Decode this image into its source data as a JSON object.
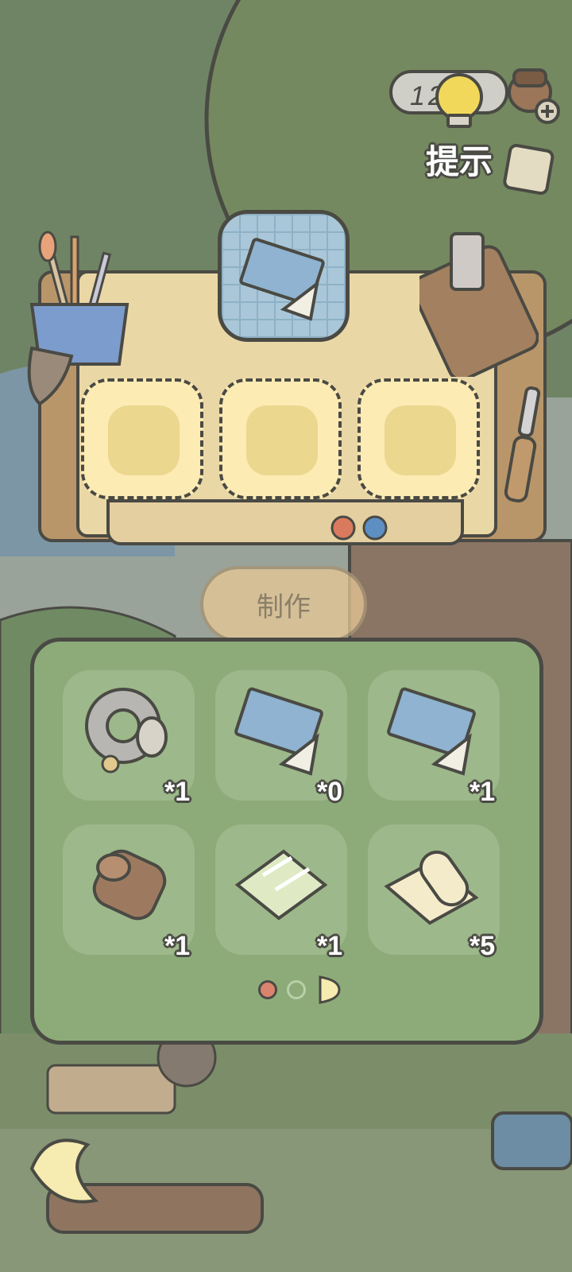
{
  "hint": {
    "counter": "12",
    "label": "提示"
  },
  "craft_button": {
    "label": "制作"
  },
  "inventory": {
    "items": [
      {
        "name": "gear-item",
        "count": "*1"
      },
      {
        "name": "blueprint-item",
        "count": "*0"
      },
      {
        "name": "blueprint-item-2",
        "count": "*1"
      },
      {
        "name": "log-item",
        "count": "*1"
      },
      {
        "name": "glass-item",
        "count": "*1"
      },
      {
        "name": "paper-scroll-item",
        "count": "*5"
      }
    ],
    "page_indicator": {
      "current": 1,
      "total": 3
    }
  },
  "colors": {
    "panel": "#8cab79",
    "bench_top": "#ead7a6",
    "slot": "#fcebb3",
    "outline": "#4a4a44"
  }
}
